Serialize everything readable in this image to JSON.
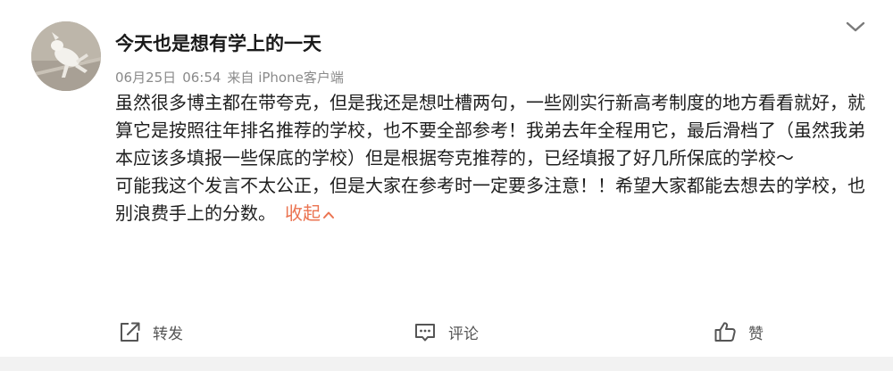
{
  "post": {
    "author_name": "今天也是想有学上的一天",
    "date": "06月25日",
    "time": "06:54",
    "source": "来自 iPhone客户端",
    "paragraphs": [
      "虽然很多博主都在带夸克，但是我还是想吐槽两句，一些刚实行新高考制度的地方看看就好，就算它是按照往年排名推荐的学校，也不要全部参考！我弟去年全程用它，最后滑档了（虽然我弟本应该多填报一些保底的学校）但是根据夸克推荐的，已经填报了好几所保底的学校～",
      "可能我这个发言不太公正，但是大家在参考时一定要多注意！！希望大家都能去想去的学校，也别浪费手上的分数。"
    ],
    "collapse_label": "收起"
  },
  "actions": {
    "repost_label": "转发",
    "comment_label": "评论",
    "like_label": "赞"
  },
  "icons": {
    "more": "chevron-down-icon",
    "collapse": "chevron-up-icon",
    "repost": "share-out-icon",
    "comment": "comment-icon",
    "like": "thumbs-up-icon"
  },
  "colors": {
    "accent": "#eb7350",
    "meta_text": "#8a8a8a",
    "body_text": "#1f1f1f"
  }
}
